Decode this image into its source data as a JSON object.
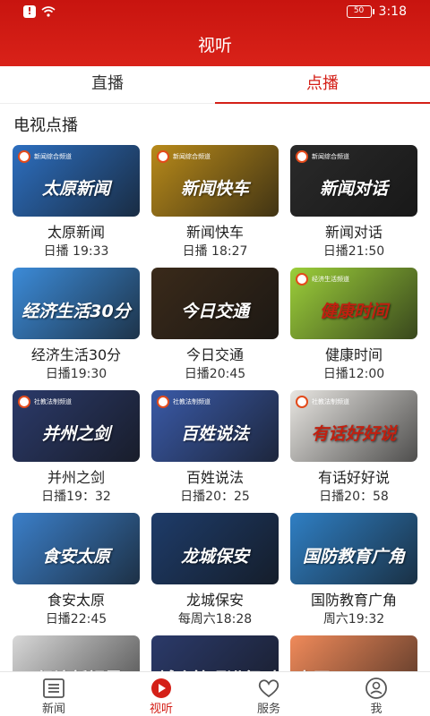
{
  "status": {
    "time": "3:18",
    "battery": "50"
  },
  "header": {
    "title": "视听"
  },
  "tabs": [
    {
      "label": "直播"
    },
    {
      "label": "点播"
    }
  ],
  "section_title": "电视点播",
  "cards": [
    {
      "title": "太原新闻",
      "schedule": "日播 19:33",
      "overlay": "太原新闻",
      "bg": "#2d6fc0",
      "logo": "新闻综合频道"
    },
    {
      "title": "新闻快车",
      "schedule": "日播 18:27",
      "overlay": "新闻快车",
      "bg": "#b88a1a",
      "logo": "新闻综合频道"
    },
    {
      "title": "新闻对话",
      "schedule": "日播21:50",
      "overlay": "新闻对话",
      "bg": "#2a2a2a",
      "logo": "新闻综合频道"
    },
    {
      "title": "经济生活30分",
      "schedule": "日播19:30",
      "overlay": "经济生活30分",
      "bg": "#3c8bd8",
      "logo": ""
    },
    {
      "title": "今日交通",
      "schedule": "日播20:45",
      "overlay": "今日交通",
      "bg": "#3a2a1a",
      "logo": ""
    },
    {
      "title": "健康时间",
      "schedule": "日播12:00",
      "overlay": "健康时间",
      "bg": "#9ccf3a",
      "logo": "经济生活频道"
    },
    {
      "title": "并州之剑",
      "schedule": "日播19：32",
      "overlay": "并州之剑",
      "bg": "#2b3a6a",
      "logo": "社教法制频道"
    },
    {
      "title": "百姓说法",
      "schedule": "日播20：25",
      "overlay": "百姓说法",
      "bg": "#3a5aa8",
      "logo": "社教法制频道"
    },
    {
      "title": "有话好好说",
      "schedule": "日播20：58",
      "overlay": "有话好好说",
      "bg": "#e8e6e2",
      "logo": "社教法制频道"
    },
    {
      "title": "食安太原",
      "schedule": "日播22:45",
      "overlay": "食安太原",
      "bg": "#3b7fc9",
      "logo": ""
    },
    {
      "title": "龙城保安",
      "schedule": "每周六18:28",
      "overlay": "龙城保安",
      "bg": "#1e3c6a",
      "logo": ""
    },
    {
      "title": "国防教育广角",
      "schedule": "周六19:32",
      "overlay": "国防教育广角",
      "bg": "#2f7fc4",
      "logo": ""
    },
    {
      "title": "",
      "schedule": "",
      "overlay": "经济新视界",
      "bg": "#d8d8d8",
      "logo": ""
    },
    {
      "title": "",
      "schedule": "",
      "overlay": "城乡管理进行时",
      "bg": "#2b3a6a",
      "logo": ""
    },
    {
      "title": "",
      "schedule": "",
      "overlay": "太原TV Smart City",
      "bg": "#f08a5a",
      "logo": ""
    }
  ],
  "bottom_nav": [
    {
      "label": "新闻",
      "icon": "news-icon"
    },
    {
      "label": "视听",
      "icon": "play-icon"
    },
    {
      "label": "服务",
      "icon": "heart-icon"
    },
    {
      "label": "我",
      "icon": "user-icon"
    }
  ],
  "colors": {
    "accent": "#d42018",
    "header_bg": "#c8140f"
  }
}
